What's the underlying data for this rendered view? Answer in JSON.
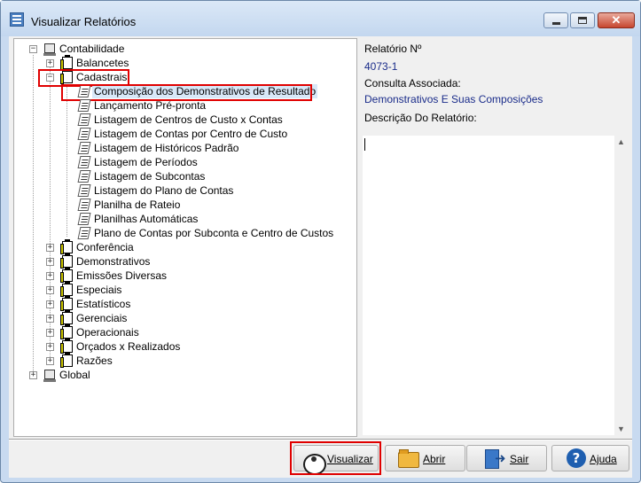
{
  "window": {
    "title": "Visualizar Relatórios"
  },
  "tree": {
    "root": "Contabilidade",
    "groups_top": [
      "Balancetes",
      "Cadastrais"
    ],
    "cadastrais_items": [
      "Composição dos Demonstrativos de Resultado",
      "Lançamento Pré-pronta",
      "Listagem de Centros de Custo x Contas",
      "Listagem de Contas por Centro de Custo",
      "Listagem de Históricos Padrão",
      "Listagem de Períodos",
      "Listagem de Subcontas",
      "Listagem do Plano de Contas",
      "Planilha de Rateio",
      "Planilhas Automáticas",
      "Plano de Contas por Subconta e Centro de Custos"
    ],
    "groups_bottom": [
      "Conferência",
      "Demonstrativos",
      "Emissões Diversas",
      "Especiais",
      "Estatísticos",
      "Gerenciais",
      "Operacionais",
      "Orçados x Realizados",
      "Razões"
    ],
    "root2": "Global"
  },
  "details": {
    "report_no_label": "Relatório Nº",
    "report_no_value": "4073-1",
    "query_label": "Consulta Associada:",
    "query_value": "Demonstrativos E Suas Composições",
    "description_label": "Descrição Do Relatório:"
  },
  "buttons": {
    "view": "Visualizar",
    "open": "Abrir",
    "exit": "Sair",
    "help": "Ajuda"
  },
  "colors": {
    "highlight": "#e00000",
    "value_text": "#1a2c8a"
  }
}
